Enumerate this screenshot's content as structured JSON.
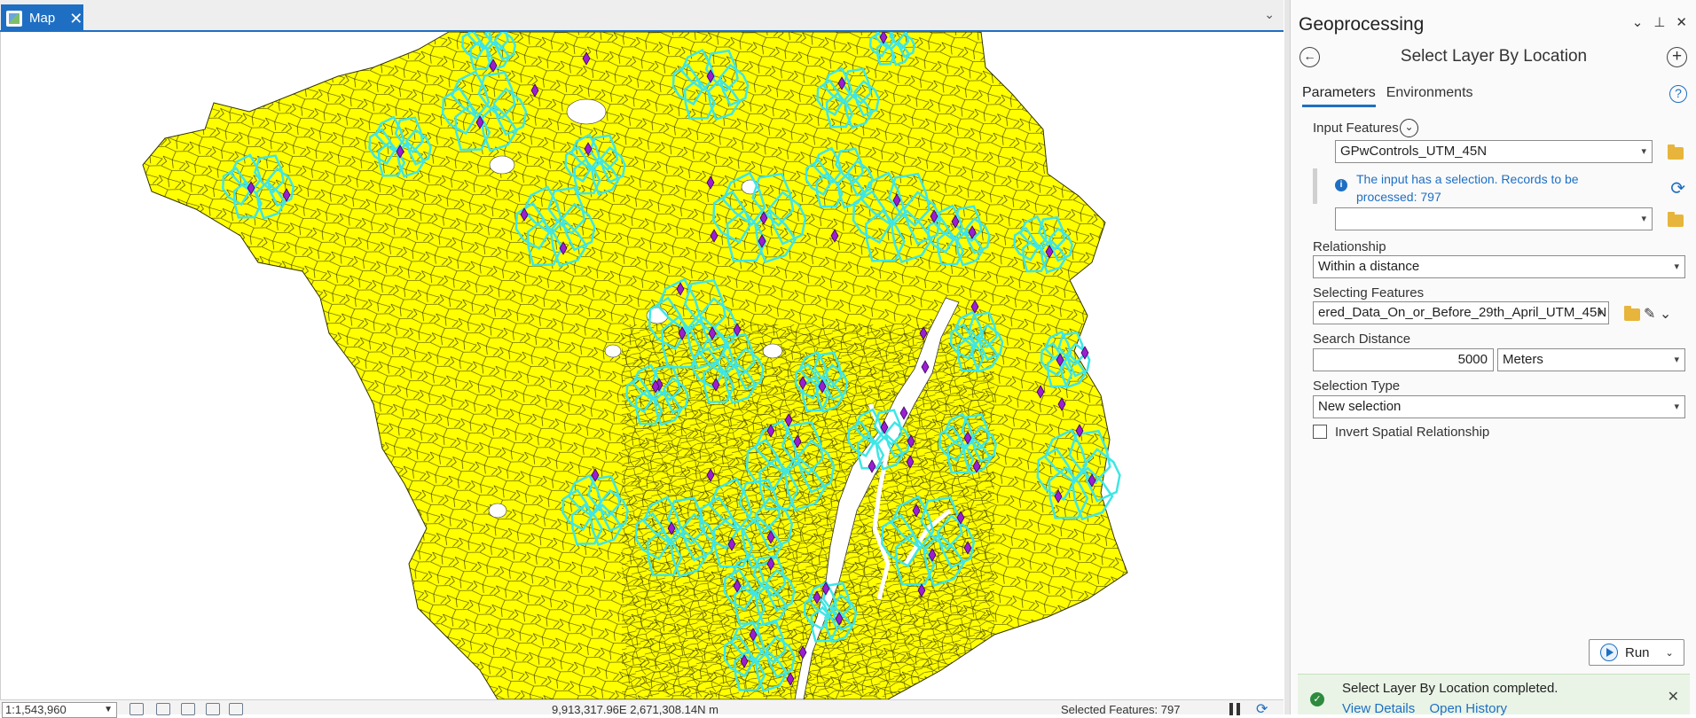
{
  "map_tab": {
    "label": "Map",
    "close": "✕",
    "menu": "⌄"
  },
  "statusbar": {
    "scale": "1:1,543,960",
    "coordinates": "9,913,317.96E 2,671,308.14N m",
    "selected": "Selected Features: 797"
  },
  "pane": {
    "title": "Geoprocessing",
    "controls": [
      "⌄",
      "⊥",
      "✕"
    ],
    "tool_title": "Select Layer By Location",
    "tabs": [
      {
        "label": "Parameters",
        "active": true
      },
      {
        "label": "Environments",
        "active": false
      }
    ],
    "help": "?",
    "input_features": {
      "label": "Input Features",
      "value": "GPwControls_UTM_45N",
      "info": "The input has a selection. Records to be processed: 797",
      "empty_value": ""
    },
    "relationship": {
      "label": "Relationship",
      "value": "Within a distance"
    },
    "selecting_features": {
      "label": "Selecting Features",
      "value": "ered_Data_On_or_Before_29th_April_UTM_45N"
    },
    "search_distance": {
      "label": "Search Distance",
      "value": "5000",
      "unit": "Meters"
    },
    "selection_type": {
      "label": "Selection Type",
      "value": "New selection"
    },
    "invert": {
      "label": "Invert Spatial Relationship",
      "checked": false
    },
    "run_label": "Run",
    "message": {
      "text": "Select Layer By Location completed.",
      "links": [
        "View Details",
        "Open History"
      ]
    }
  },
  "colors": {
    "accent": "#1e6fc3",
    "polygon_fill": "#ffff00",
    "selected_outline": "#3ee6e6",
    "point_marker": "#9b1fd1",
    "success_bg": "#e9f4e6"
  }
}
